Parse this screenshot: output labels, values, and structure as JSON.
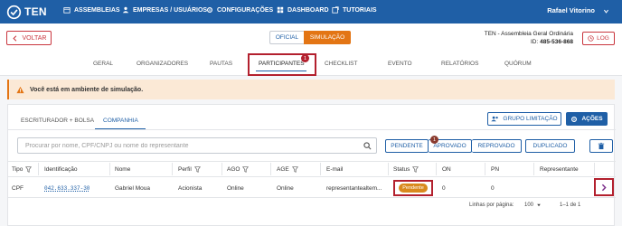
{
  "topbar": {
    "logo_text": "TEN",
    "nav": [
      {
        "label": "ASSEMBLEIAS",
        "icon": "calendar-icon"
      },
      {
        "label": "EMPRESAS / USUÁRIOS",
        "icon": "users-icon"
      },
      {
        "label": "CONFIGURAÇÕES",
        "icon": "gears-icon"
      },
      {
        "label": "DASHBOARD",
        "icon": "dashboard-icon"
      },
      {
        "label": "TUTORIAIS",
        "icon": "external-link-icon"
      }
    ],
    "user_name": "Rafael Vitorino",
    "user_menu_icon": "chevron-down-icon"
  },
  "header": {
    "back_label": "VOLTAR",
    "mode_oficial": "OFICIAL",
    "mode_simulacao": "SIMULAÇÃO",
    "meeting_title": "TEN - Assembleia Geral Ordinária",
    "meeting_id_label": "ID:",
    "meeting_id": "485-536-868",
    "log_label": "LOG",
    "tabs": [
      "GERAL",
      "ORGANIZADORES",
      "PAUTAS",
      "PARTICIPANTES",
      "CHECKLIST",
      "EVENTO",
      "RELATÓRIOS",
      "QUÓRUM"
    ],
    "active_tab": "PARTICIPANTES",
    "active_tab_badge": "1"
  },
  "alert": {
    "text": "Você está em ambiente de simulação.",
    "icon": "warning-icon"
  },
  "participants": {
    "sub_tabs": [
      "ESCRITURADOR + BOLSA",
      "COMPANHIA"
    ],
    "active_sub_tab": "COMPANHIA",
    "group_button": "GRUPO LIMITAÇÃO",
    "actions_button": "AÇÕES",
    "search_placeholder": "Procurar por nome, CPF/CNPJ ou nome do representante",
    "filters": [
      "PENDENTE",
      "APROVADO",
      "REPROVADO",
      "DUPLICADO"
    ],
    "filters_badge": "1",
    "columns": [
      "Tipo",
      "Identificação",
      "Nome",
      "Perfil",
      "AGO",
      "AGE",
      "E-mail",
      "Status",
      "ON",
      "PN",
      "Representante"
    ],
    "rows": [
      {
        "tipo": "CPF",
        "identificacao": "042.633.337-30",
        "nome": "Gabriel Moua",
        "perfil": "Acionista",
        "ago": "Online",
        "age": "Online",
        "email": "representantealtem...",
        "status": "Pendente",
        "on": "0",
        "pn": "0",
        "representante": ""
      }
    ],
    "status_color": "#d98a1e",
    "pagination": {
      "rows_per_page_label": "Linhas por página:",
      "rows_per_page": "100",
      "range": "1–1 de 1"
    }
  },
  "colors": {
    "primary": "#1f5fa6",
    "simulation": "#e37514",
    "danger": "#c9363e",
    "alert_bg": "#fbe9d6"
  }
}
